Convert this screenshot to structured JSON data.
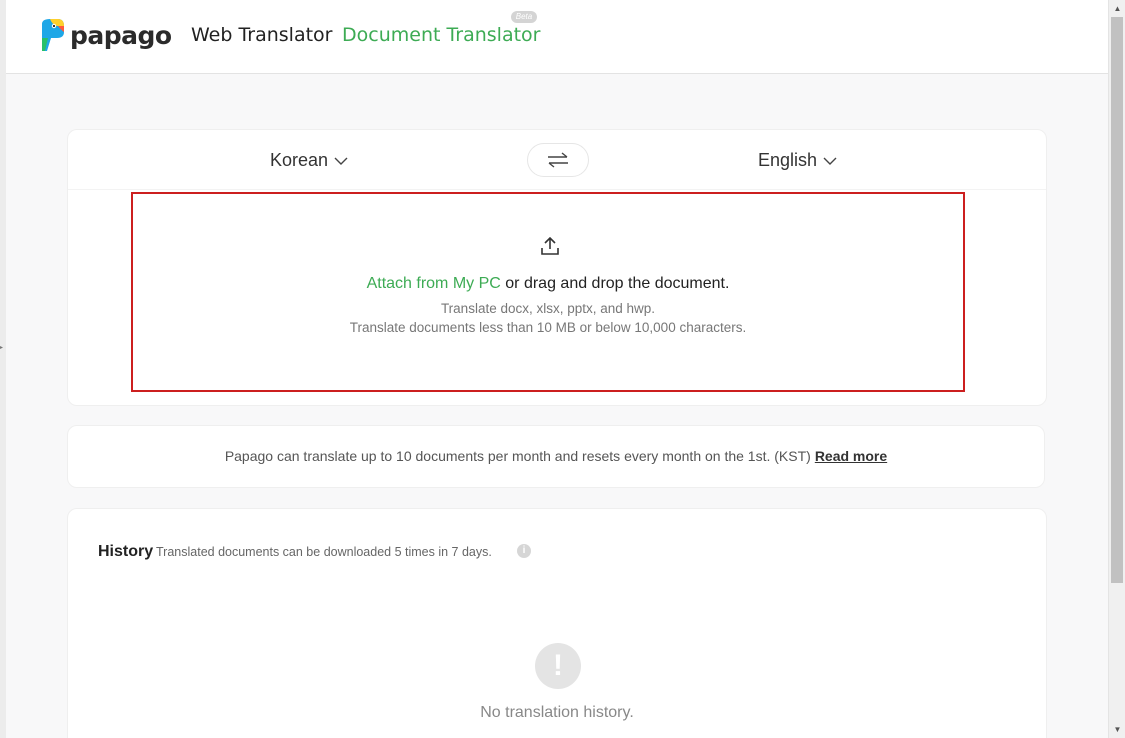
{
  "header": {
    "logo_text": "papago",
    "nav_web_translator": "Web Translator",
    "nav_document_translator": "Document Translator",
    "beta_badge": "Beta"
  },
  "translate": {
    "source_language": "Korean",
    "target_language": "English",
    "attach_link": "Attach from My PC",
    "attach_rest": " or drag and drop the document.",
    "supported_formats": "Translate docx, xlsx, pptx, and hwp.",
    "size_limit": "Translate documents less than 10 MB or below 10,000 characters."
  },
  "notice": {
    "text": "Papago can translate up to 10 documents per month and resets every month on the 1st. (KST)",
    "read_more": "Read more"
  },
  "history": {
    "title": "History",
    "description": "Translated documents can be downloaded 5 times in 7 days.",
    "info_icon": "i",
    "empty_icon": "!",
    "empty_text": "No translation history."
  },
  "scrollbar": {
    "up_arrow": "▲",
    "down_arrow": "▼",
    "left_arrow": "▸"
  },
  "colors": {
    "brand_green": "#3dab54",
    "highlight_red": "#cc1f1f"
  }
}
